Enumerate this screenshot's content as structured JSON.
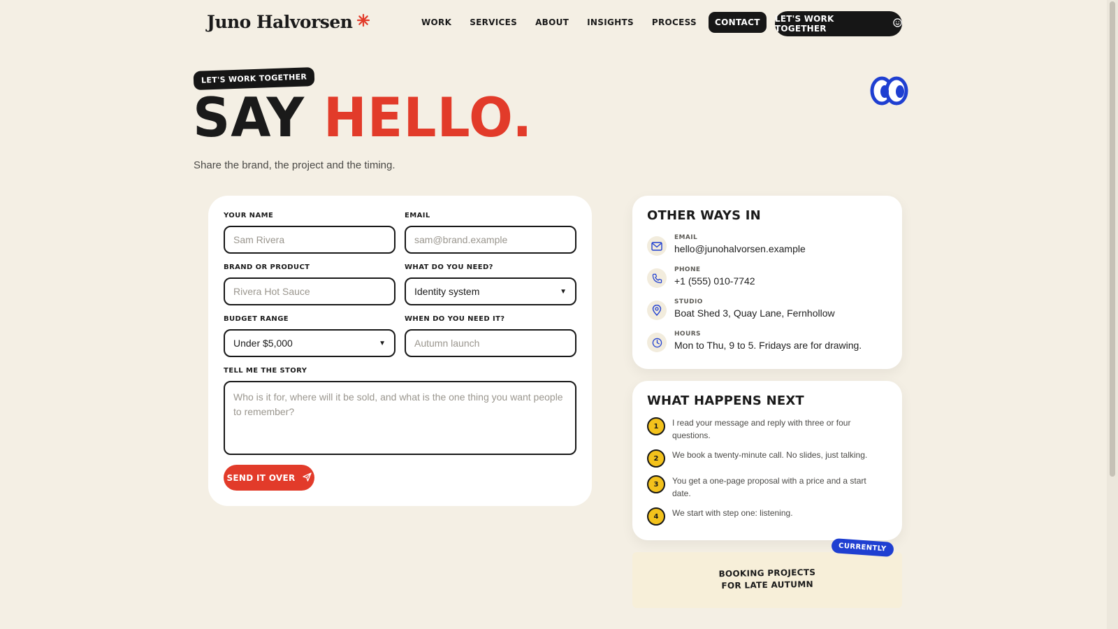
{
  "brand": {
    "name": "Juno Halvorsen",
    "mark_icon": "asterisk-icon",
    "accent": "#e23b2a"
  },
  "nav": {
    "items": [
      {
        "label": "WORK",
        "active": false
      },
      {
        "label": "SERVICES",
        "active": false
      },
      {
        "label": "ABOUT",
        "active": false
      },
      {
        "label": "INSIGHTS",
        "active": false
      },
      {
        "label": "PROCESS",
        "active": false
      },
      {
        "label": "CONTACT",
        "active": true
      }
    ],
    "cta_label": "LET'S WORK TOGETHER",
    "cta_icon": "smile-icon"
  },
  "hero": {
    "eyebrow": "LET'S WORK TOGETHER",
    "title_part1": "SAY",
    "title_part2": "HELLO.",
    "subtitle": "Share the brand, the project and the timing.",
    "decor_icon": "eyes-icon"
  },
  "form": {
    "name": {
      "label": "YOUR NAME",
      "placeholder": "Sam Rivera",
      "value": ""
    },
    "email": {
      "label": "EMAIL",
      "placeholder": "sam@brand.example",
      "value": ""
    },
    "brand": {
      "label": "BRAND OR PRODUCT",
      "placeholder": "Rivera Hot Sauce",
      "value": ""
    },
    "need": {
      "label": "WHAT DO YOU NEED?",
      "selected": "Identity system"
    },
    "budget": {
      "label": "BUDGET RANGE",
      "selected": "Under $5,000"
    },
    "when": {
      "label": "WHEN DO YOU NEED IT?",
      "placeholder": "Autumn launch",
      "value": ""
    },
    "story": {
      "label": "TELL ME THE STORY",
      "placeholder": "Who is it for, where will it be sold, and what is the one thing you want people to remember?",
      "value": ""
    },
    "submit_label": "SEND IT OVER",
    "submit_icon": "paper-plane-icon"
  },
  "contact_card": {
    "title": "OTHER WAYS IN",
    "rows": [
      {
        "icon": "mail-icon",
        "label": "EMAIL",
        "value": "hello@junohalvorsen.example"
      },
      {
        "icon": "phone-icon",
        "label": "PHONE",
        "value": "+1 (555) 010-7742"
      },
      {
        "icon": "map-pin-icon",
        "label": "STUDIO",
        "value": "Boat Shed 3, Quay Lane, Fernhollow"
      },
      {
        "icon": "clock-icon",
        "label": "HOURS",
        "value": "Mon to Thu, 9 to 5. Fridays are for drawing."
      }
    ]
  },
  "next_card": {
    "title": "WHAT HAPPENS NEXT",
    "steps": [
      {
        "num": "1",
        "text": "I read your message and reply with three or four questions."
      },
      {
        "num": "2",
        "text": "We book a twenty-minute call. No slides, just talking."
      },
      {
        "num": "3",
        "text": "You get a one-page proposal with a price and a start date."
      },
      {
        "num": "4",
        "text": "We start with step one: listening."
      }
    ]
  },
  "status": {
    "badge": "CURRENTLY",
    "line1": "BOOKING PROJECTS",
    "line2": "FOR LATE AUTUMN"
  },
  "colors": {
    "background": "#f4efe4",
    "ink": "#171717",
    "red": "#e23b2a",
    "blue": "#1f3fd1",
    "yellow": "#f3c21c"
  }
}
